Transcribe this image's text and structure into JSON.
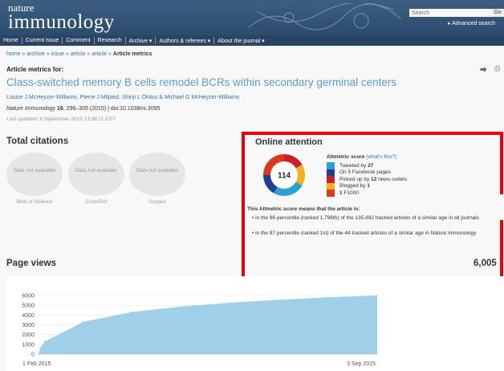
{
  "header": {
    "logo_line1": "nature",
    "logo_line2": "immunology",
    "search_placeholder": "Search",
    "go_label": "Go",
    "advanced_search": "▸ Advanced search"
  },
  "nav": {
    "items": [
      "Home",
      "Current issue",
      "Comment",
      "Research",
      "Archive ▾",
      "Authors & referees ▾",
      "About the journal ▾"
    ]
  },
  "breadcrumb": {
    "links": [
      "home",
      "archive",
      "issue",
      "article",
      "article"
    ],
    "separator": " » ",
    "current": "Article metrics"
  },
  "article": {
    "metrics_for": "Article metrics for:",
    "title": "Class-switched memory B cells remodel BCRs within secondary germinal centers",
    "authors": "Louise J McHeyzer-Williams, Pierre J Milpied, Shinji L Okitsu & Michael G McHeyzer-Williams",
    "journal": "Nature Immunology",
    "volume": "16",
    "pages_doi": ", 296–305 (2015)  |  doi:10.1038/ni.3095",
    "last_updated": "Last updated: 8 September 2015 13:36:11 EDT"
  },
  "citations": {
    "title": "Total citations",
    "items": [
      {
        "text": "Data not available",
        "label": "Web of Science"
      },
      {
        "text": "Data not available",
        "label": "CrossRef"
      },
      {
        "text": "Data not available",
        "label": "Scopus"
      }
    ]
  },
  "attention": {
    "title": "Online attention",
    "score": "114",
    "score_label": "Altmetric score",
    "whats_this": "(what's this?)",
    "mentions": [
      {
        "text": "Tweeted by ",
        "num": "27",
        "color": "#2e9fd6"
      },
      {
        "text": "On 5 Facebook pages",
        "num": "",
        "color": "#1f3f8f"
      },
      {
        "text": "Picked up by ",
        "num": "12",
        "suffix": " news outlets",
        "color": "#c9202a"
      },
      {
        "text": "Blogged by ",
        "num": "1",
        "color": "#f2b120"
      },
      {
        "text": "",
        "num": "1",
        "suffix": " F1000",
        "color": "#d83a1a"
      }
    ],
    "means_title": "This Altmetric score means that the article is:",
    "percentiles": [
      "• in the 96 percentile (ranked 1,796th) of the 135,492 tracked articles of a similar age in all journals",
      "• in the 97 percentile (ranked 1st) of the 44 tracked articles of a similar age in Nature Immunology"
    ]
  },
  "page_views": {
    "title": "Page views",
    "total": "6,005"
  },
  "chart_data": {
    "type": "area",
    "title": "",
    "xlabel": "",
    "ylabel": "",
    "ylim": [
      0,
      6000
    ],
    "yticks": [
      "0",
      "1000",
      "2000",
      "3000",
      "4000",
      "5000",
      "6000"
    ],
    "xtick_labels": [
      "1 Feb 2015",
      "3 Sep 2015"
    ],
    "x": [
      "1 Feb 2015",
      "2 Feb 2015",
      "5 Feb 2015",
      "15 Feb 2015",
      "1 Mar 2015",
      "1 Apr 2015",
      "1 May 2015",
      "1 Jun 2015",
      "1 Jul 2015",
      "1 Aug 2015",
      "3 Sep 2015"
    ],
    "values": [
      0,
      600,
      1300,
      2100,
      3300,
      4300,
      4850,
      5250,
      5550,
      5800,
      6005
    ],
    "color": "#9fcfe9"
  }
}
